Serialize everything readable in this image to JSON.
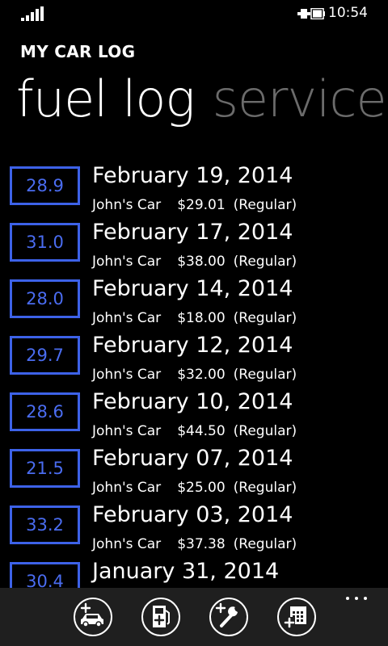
{
  "status_bar": {
    "time": "10:54",
    "signal_icon": "signal-strength-icon",
    "battery_icon": "battery-charging-icon"
  },
  "header": {
    "app_title": "MY CAR LOG",
    "pivots": [
      {
        "label": "fuel log",
        "active": true
      },
      {
        "label": "service",
        "active": false
      }
    ]
  },
  "accent_color": "#3d62e8",
  "entries": [
    {
      "mpg": "28.9",
      "date": "February 19, 2014",
      "car": "John's Car",
      "cost": "$29.01",
      "grade": "(Regular)"
    },
    {
      "mpg": "31.0",
      "date": "February 17, 2014",
      "car": "John's Car",
      "cost": "$38.00",
      "grade": "(Regular)"
    },
    {
      "mpg": "28.0",
      "date": "February 14, 2014",
      "car": "John's Car",
      "cost": "$18.00",
      "grade": "(Regular)"
    },
    {
      "mpg": "29.7",
      "date": "February 12, 2014",
      "car": "John's Car",
      "cost": "$32.00",
      "grade": "(Regular)"
    },
    {
      "mpg": "28.6",
      "date": "February 10, 2014",
      "car": "John's Car",
      "cost": "$44.50",
      "grade": "(Regular)"
    },
    {
      "mpg": "21.5",
      "date": "February 07, 2014",
      "car": "John's Car",
      "cost": "$25.00",
      "grade": "(Regular)"
    },
    {
      "mpg": "33.2",
      "date": "February 03, 2014",
      "car": "John's Car",
      "cost": "$37.38",
      "grade": "(Regular)"
    },
    {
      "mpg": "30.4",
      "date": "January 31, 2014",
      "car": "",
      "cost": "",
      "grade": ""
    }
  ],
  "app_bar": {
    "buttons": [
      {
        "icon": "add-car-icon"
      },
      {
        "icon": "add-fuel-icon"
      },
      {
        "icon": "add-service-icon"
      },
      {
        "icon": "add-calendar-icon"
      }
    ],
    "more_icon": "more-ellipsis-icon"
  }
}
